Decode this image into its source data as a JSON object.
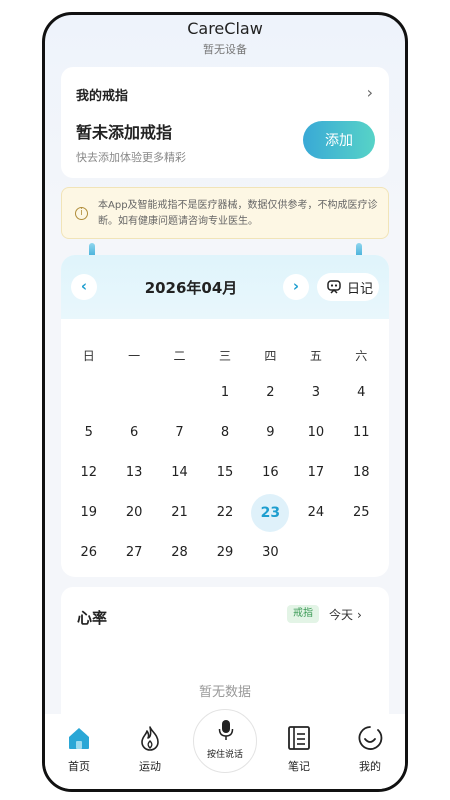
{
  "header": {
    "title": "CareClaw",
    "subtitle": "暂无设备"
  },
  "ring_card": {
    "title": "我的戒指",
    "main_text": "暂未添加戒指",
    "sub_text": "快去添加体验更多精彩",
    "add_label": "添加"
  },
  "disclaimer": {
    "text": "本App及智能戒指不是医疗器械，数据仅供参考，不构成医疗诊断。如有健康问题请咨询专业医生。"
  },
  "calendar": {
    "month_label": "2026年04月",
    "prev_glyph": "‹",
    "next_glyph": "›",
    "diary_label": "日记",
    "weekdays": [
      "日",
      "一",
      "二",
      "三",
      "四",
      "五",
      "六"
    ],
    "first_weekday_index": 3,
    "days_in_month": 30,
    "today": 23
  },
  "heart_rate": {
    "title": "心率",
    "badge": "戒指",
    "period_label": "今天",
    "empty_text": "暂无数据"
  },
  "bottom_nav": {
    "home": "首页",
    "sport": "运动",
    "voice": "按住说话",
    "notes": "笔记",
    "mine": "我的"
  },
  "colors": {
    "accent": "#1e9ecf",
    "home_icon": "#2aa7d6"
  }
}
